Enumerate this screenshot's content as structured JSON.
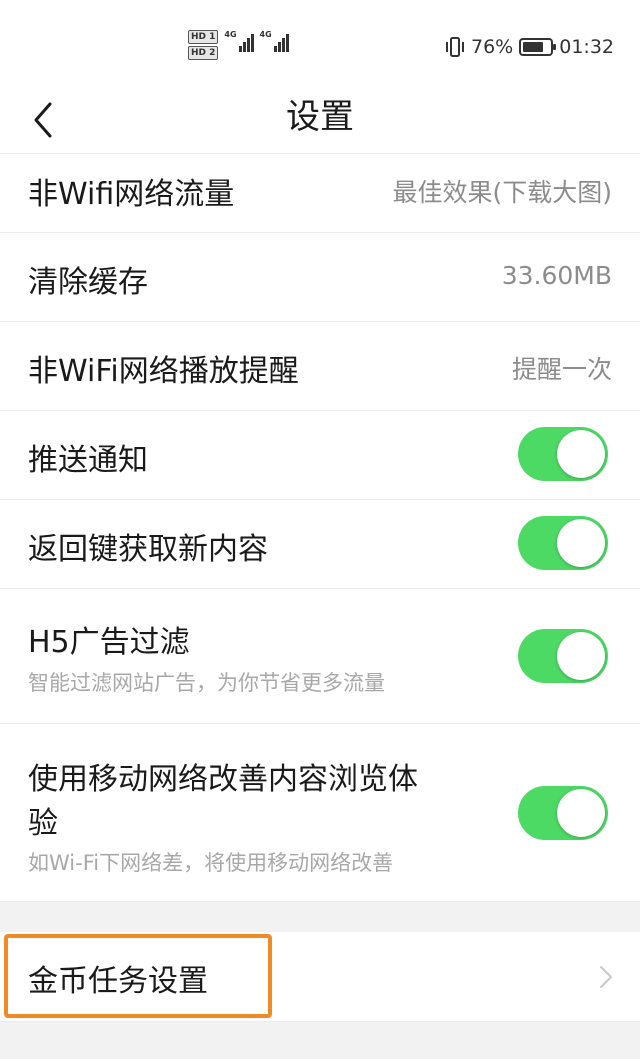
{
  "status_bar": {
    "hd1": "HD 1",
    "hd2": "HD 2",
    "net1": "4G",
    "net2": "4G",
    "battery_percent": "76%",
    "battery_level": 0.76,
    "time": "01:32",
    "icons": [
      "vibrate-icon",
      "battery-icon",
      "signal-icon"
    ]
  },
  "header": {
    "title": "设置",
    "back_icon": "chevron-left-icon"
  },
  "settings": {
    "non_wifi_traffic": {
      "label": "非Wifi网络流量",
      "value": "最佳效果(下载大图)"
    },
    "clear_cache": {
      "label": "清除缓存",
      "value": "33.60MB"
    },
    "non_wifi_play_reminder": {
      "label": "非WiFi网络播放提醒",
      "value": "提醒一次"
    },
    "push_notifications": {
      "label": "推送通知",
      "on": true
    },
    "back_key_refresh": {
      "label": "返回键获取新内容",
      "on": true
    },
    "h5_ad_filter": {
      "label": "H5广告过滤",
      "sub": "智能过滤网站广告，为你节省更多流量",
      "on": true
    },
    "mobile_network_boost": {
      "label_line1": "使用移动网络改善内容浏览体",
      "label_line2": "验",
      "sub": "如Wi-Fi下网络差，将使用移动网络改善",
      "on": true
    },
    "coin_task": {
      "label": "金币任务设置",
      "chevron_icon": "chevron-right-icon"
    }
  },
  "colors": {
    "toggle_on": "#4cd964",
    "highlight_border": "#f08a24",
    "section_gap": "#f2f2f2"
  }
}
